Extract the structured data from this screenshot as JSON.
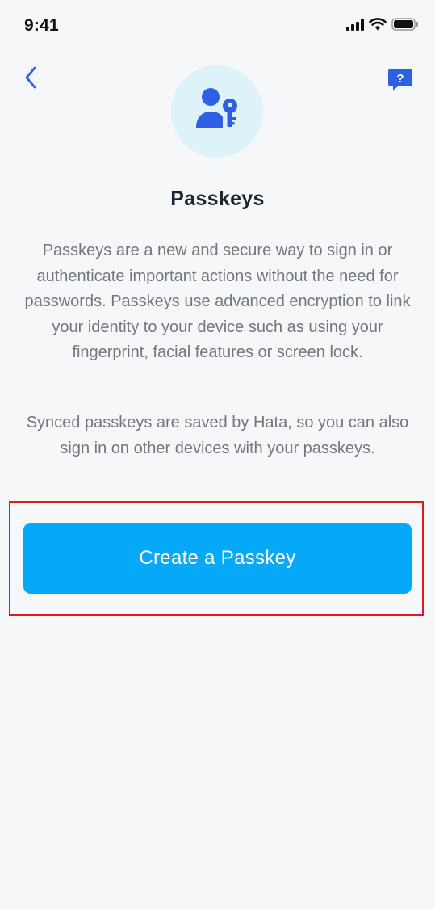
{
  "status_bar": {
    "time": "9:41"
  },
  "icons": {
    "back": "chevron-left-icon",
    "help": "help-chat-bubble-icon",
    "help_glyph": "?",
    "hero": "user-key-icon",
    "signal": "cellular-signal-icon",
    "wifi": "wifi-icon",
    "battery": "battery-icon"
  },
  "colors": {
    "accent": "#05a9f7",
    "icon_blue": "#2f5fe3",
    "hero_bg": "#def2fa",
    "highlight_border": "#e01b1b"
  },
  "main": {
    "title": "Passkeys",
    "paragraph_1": "Passkeys are a new and secure way to sign in or authenticate important actions without the need for passwords. Passkeys use advanced encryption to link your identity to your device such as using your fingerprint, facial features or screen lock.",
    "paragraph_2": "Synced passkeys are saved by Hata, so you can also sign in on other devices with your passkeys.",
    "cta_label": "Create a Passkey"
  }
}
